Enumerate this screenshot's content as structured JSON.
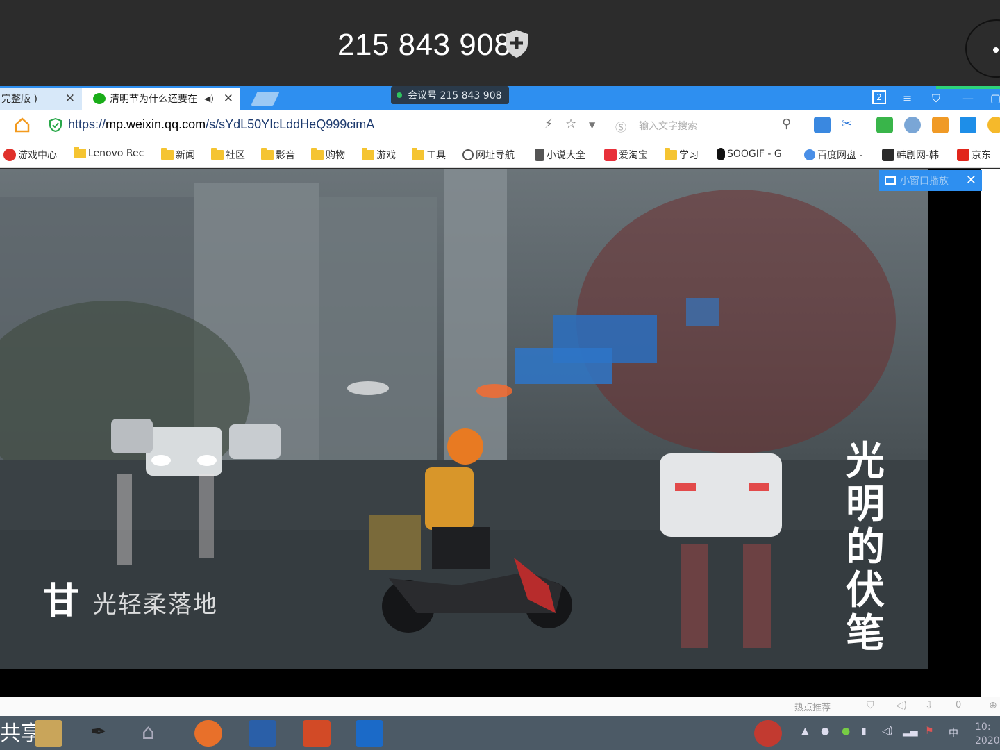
{
  "meeting": {
    "id_display": "215 843 908",
    "pill_label": "会议号 215 843 908"
  },
  "browser": {
    "tabs": [
      {
        "label": "完整版 )",
        "active": false
      },
      {
        "label": "清明节为什么还要在",
        "active": true
      }
    ],
    "url_prefix": "https://",
    "url_domain": "mp.weixin.qq.com",
    "url_path": "/s/sYdL50YIcLddHeQ999cimA",
    "search_placeholder": "输入文字搜索",
    "badge_count": "2"
  },
  "bookmarks": [
    {
      "label": "游戏中心",
      "icon": "sogou-icon"
    },
    {
      "label": "Lenovo Rec",
      "icon": "folder-icon"
    },
    {
      "label": "新闻",
      "icon": "folder-icon"
    },
    {
      "label": "社区",
      "icon": "folder-icon"
    },
    {
      "label": "影音",
      "icon": "folder-icon"
    },
    {
      "label": "购物",
      "icon": "folder-icon"
    },
    {
      "label": "游戏",
      "icon": "folder-icon"
    },
    {
      "label": "工具",
      "icon": "folder-icon"
    },
    {
      "label": "网址导航",
      "icon": "globe-icon"
    },
    {
      "label": "小说大全",
      "icon": "book-icon"
    },
    {
      "label": "爱淘宝",
      "icon": "taobao-icon"
    },
    {
      "label": "学习",
      "icon": "folder-icon"
    },
    {
      "label": "SOOGIF - G",
      "icon": "soogif-icon"
    },
    {
      "label": "百度网盘 -",
      "icon": "baidu-pan-icon"
    },
    {
      "label": "韩剧网-韩",
      "icon": "hanju-icon"
    },
    {
      "label": "京东",
      "icon": "jd-icon"
    }
  ],
  "video": {
    "mini_window_label": "小窗口播放",
    "subtitle_mark": "甘",
    "subtitle": "光轻柔落地",
    "calligraphy": [
      "光",
      "明",
      "的",
      "伏",
      "笔"
    ]
  },
  "status_bar": {
    "hot_label": "热点推荐",
    "count": "0"
  },
  "taskbar": {
    "share_label": "共享",
    "tray_lang": "中",
    "clock_time": "10:",
    "clock_date": "2020/"
  },
  "colors": {
    "tab_blue": "#2e8ff0",
    "meeting_bg": "#2c2c2c",
    "taskbar": "#4c5a66"
  }
}
